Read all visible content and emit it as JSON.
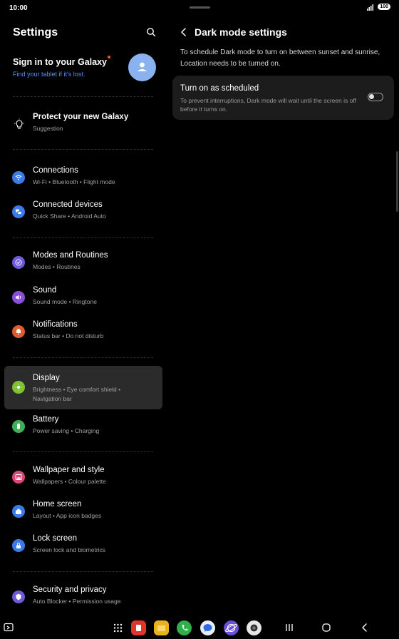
{
  "status_bar": {
    "time": "10:00",
    "battery": "100"
  },
  "settings": {
    "title": "Settings",
    "account": {
      "title": "Sign in to your Galaxy",
      "subtitle": "Find your tablet if it's lost."
    },
    "suggestion": {
      "title": "Protect your new Galaxy",
      "subtitle": "Suggestion"
    },
    "items": [
      {
        "title": "Connections",
        "subtitle": "Wi-Fi  •  Bluetooth  •  Flight mode",
        "color": "#3b7be6",
        "icon": "wifi-icon"
      },
      {
        "title": "Connected devices",
        "subtitle": "Quick Share  •  Android Auto",
        "color": "#3b7be6",
        "icon": "devices-icon"
      },
      {
        "title": "Modes and Routines",
        "subtitle": "Modes  •  Routines",
        "color": "#6f5bd8",
        "icon": "check-circle-icon"
      },
      {
        "title": "Sound",
        "subtitle": "Sound mode  •  Ringtone",
        "color": "#8a4fd8",
        "icon": "speaker-icon"
      },
      {
        "title": "Notifications",
        "subtitle": "Status bar  •  Do not disturb",
        "color": "#e35a2c",
        "icon": "bell-icon"
      },
      {
        "title": "Display",
        "subtitle": "Brightness  •  Eye comfort shield  •",
        "subtitle2": "Navigation bar",
        "color": "#7ec232",
        "icon": "sun-icon"
      },
      {
        "title": "Battery",
        "subtitle": "Power saving  •  Charging",
        "color": "#3fae55",
        "icon": "battery-icon"
      },
      {
        "title": "Wallpaper and style",
        "subtitle": "Wallpapers  •  Colour palette",
        "color": "#d9487a",
        "icon": "image-icon"
      },
      {
        "title": "Home screen",
        "subtitle": "Layout  •  App icon badges",
        "color": "#3b7be6",
        "icon": "home-icon"
      },
      {
        "title": "Lock screen",
        "subtitle": "Screen lock and biometrics",
        "color": "#3b7be6",
        "icon": "lock-icon"
      },
      {
        "title": "Security and privacy",
        "subtitle": "Auto Blocker  •  Permission usage",
        "color": "#6f5bd8",
        "icon": "shield-icon"
      }
    ]
  },
  "dark_mode": {
    "title": "Dark mode settings",
    "info": "To schedule Dark mode to turn on between sunset and sunrise, Location needs to be turned on.",
    "option": {
      "title": "Turn on as scheduled",
      "subtitle": "To prevent interruptions, Dark mode will wait until the screen is off before it turns on.",
      "enabled": false
    }
  },
  "dock": {
    "apps": [
      {
        "name": "apps-grid-icon",
        "color": "#000000"
      },
      {
        "name": "red-app-icon",
        "color": "#e0342c"
      },
      {
        "name": "notes-icon",
        "color": "#e8b21a"
      },
      {
        "name": "phone-icon",
        "color": "#2fb14a"
      },
      {
        "name": "messages-icon",
        "color": "#e8eef8"
      },
      {
        "name": "internet-icon",
        "color": "#6b4fd8"
      },
      {
        "name": "camera-icon",
        "color": "#e6e6e6"
      }
    ]
  }
}
